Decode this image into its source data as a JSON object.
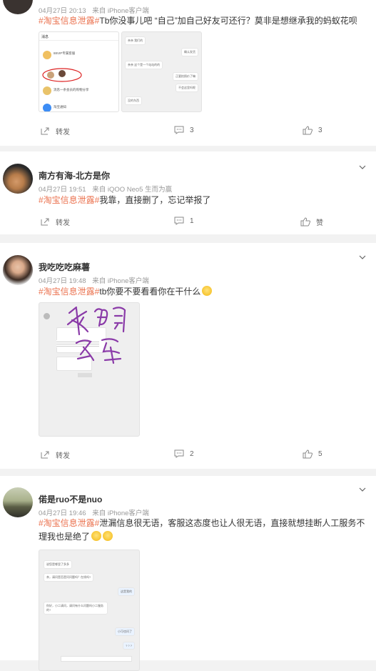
{
  "posts": [
    {
      "username": "",
      "date": "04月27日 20:13",
      "source": "来自 iPhone客户端",
      "tag": "#淘宝信息泄露#",
      "text": "Tb你没事儿吧 “自己”加自己好友可还行？莫非是想继承我的蚂蚁花呗",
      "thumb_left": {
        "header": "消息",
        "items": [
          "88VIP专属客服",
          "消息一条会员的购物分享",
          "淘宝通知"
        ]
      },
      "thumb_right": {
        "bubbles": [
          "亲亲 我们的",
          "确认发货",
          "亲亲 这个是一个站站的的",
          "正要拍照价了嘛",
          "不会这里吗呢",
          "没的东西"
        ]
      },
      "repost_label": "转发",
      "comment_count": "3",
      "like_count": "3"
    },
    {
      "username": "南方有海-北方是你",
      "date": "04月27日 19:51",
      "source": "来自 iQOO Neo5 生而为赢",
      "tag": "#淘宝信息泄露#",
      "text": "我靠，直接删了，忘记举报了",
      "repost_label": "转发",
      "comment_count": "1",
      "like_label": "赞"
    },
    {
      "username": "我吃吃吃麻薯",
      "date": "04月27日 19:48",
      "source": "来自 iPhone客户端",
      "tag": "#淘宝信息泄露#",
      "text": "tb你要不要看看你在干什么",
      "handwriting": "我的名字",
      "repost_label": "转发",
      "comment_count": "2",
      "like_count": "5"
    },
    {
      "username": "偌是ruo不是nuo",
      "date": "04月27日 19:46",
      "source": "来自 iPhone客户端",
      "tag": "#淘宝信息泄露#",
      "text": "泄漏信息很无语，客服这态度也让人很无语，直接就想挂断人工服务不理我也是绝了",
      "chat_bubbles": [
        "说您是哪里了多多",
        "亲，请问是否是问问题吗？在线吗?",
        "这是我的",
        "你好，小二请问，请问有什么问题吗小二服务的?",
        "小可也问了",
        "? ? ?"
      ]
    }
  ],
  "colors": {
    "tag": "#eb7350",
    "background": "#f2f2f2",
    "meta": "#999999",
    "handwriting": "#8a3aa8"
  }
}
